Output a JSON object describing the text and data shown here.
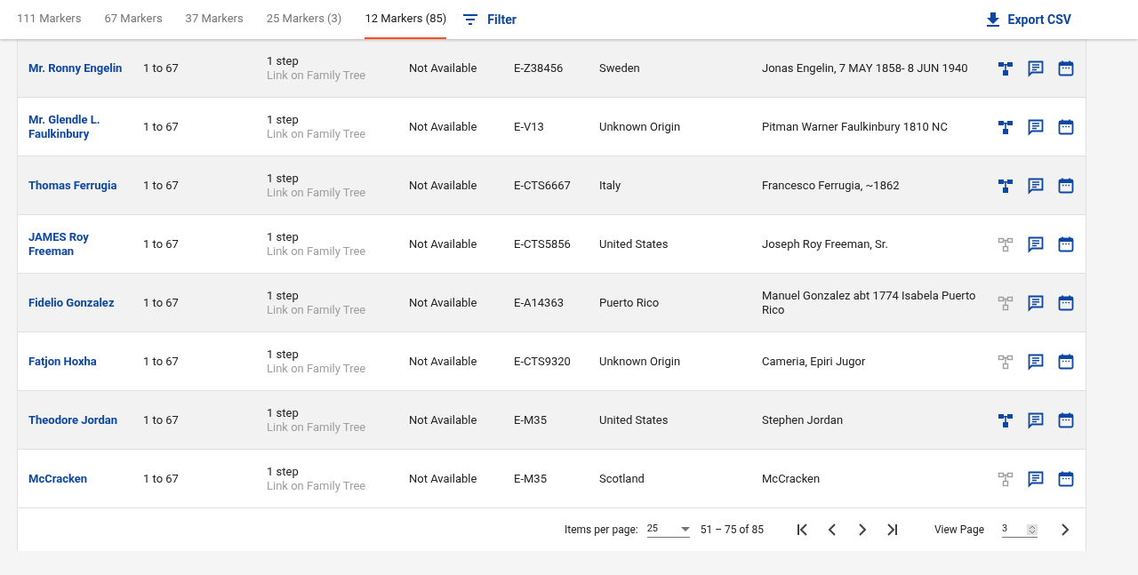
{
  "tabs": [
    {
      "label": "111 Markers",
      "selected": false
    },
    {
      "label": "67 Markers",
      "selected": false
    },
    {
      "label": "37 Markers",
      "selected": false
    },
    {
      "label": "25 Markers (3)",
      "selected": false
    },
    {
      "label": "12 Markers (85)",
      "selected": true
    }
  ],
  "filter_button": "Filter",
  "export_button": "Export CSV",
  "rows": [
    {
      "name": "Mr. Ronny Engelin",
      "markers": "1 to 67",
      "steps": "1 step",
      "link": "Link on Family Tree",
      "availability": "Not Available",
      "haplogroup": "E-Z38456",
      "origin": "Sweden",
      "ancestor": "Jonas Engelin, 7 MAY 1858- 8 JUN 1940",
      "tree_linked": true
    },
    {
      "name": "Mr. Glendle L. Faulkinbury",
      "markers": "1 to 67",
      "steps": "1 step",
      "link": "Link on Family Tree",
      "availability": "Not Available",
      "haplogroup": "E-V13",
      "origin": "Unknown Origin",
      "ancestor": "Pitman Warner Faulkinbury 1810 NC",
      "tree_linked": true
    },
    {
      "name": "Thomas Ferrugia",
      "markers": "1 to 67",
      "steps": "1 step",
      "link": "Link on Family Tree",
      "availability": "Not Available",
      "haplogroup": "E-CTS6667",
      "origin": "Italy",
      "ancestor": "Francesco Ferrugia, ~1862",
      "tree_linked": true
    },
    {
      "name": "JAMES Roy Freeman",
      "markers": "1 to 67",
      "steps": "1 step",
      "link": "Link on Family Tree",
      "availability": "Not Available",
      "haplogroup": "E-CTS5856",
      "origin": "United States",
      "ancestor": "Joseph Roy Freeman, Sr.",
      "tree_linked": false
    },
    {
      "name": "Fidelio Gonzalez",
      "markers": "1 to 67",
      "steps": "1 step",
      "link": "Link on Family Tree",
      "availability": "Not Available",
      "haplogroup": "E-A14363",
      "origin": "Puerto Rico",
      "ancestor": "Manuel Gonzalez abt 1774 Isabela Puerto Rico",
      "tree_linked": false
    },
    {
      "name": "Fatjon Hoxha",
      "markers": "1 to 67",
      "steps": "1 step",
      "link": "Link on Family Tree",
      "availability": "Not Available",
      "haplogroup": "E-CTS9320",
      "origin": "Unknown Origin",
      "ancestor": "Cameria, Epiri Jugor",
      "tree_linked": false
    },
    {
      "name": "Theodore Jordan",
      "markers": "1 to 67",
      "steps": "1 step",
      "link": "Link on Family Tree",
      "availability": "Not Available",
      "haplogroup": "E-M35",
      "origin": "United States",
      "ancestor": "Stephen Jordan",
      "tree_linked": true
    },
    {
      "name": "McCracken",
      "markers": "1 to 67",
      "steps": "1 step",
      "link": "Link on Family Tree",
      "availability": "Not Available",
      "haplogroup": "E-M35",
      "origin": "Scotland",
      "ancestor": "McCracken",
      "tree_linked": false
    }
  ],
  "paginator": {
    "items_per_page_label": "Items per page:",
    "items_per_page": "25",
    "range": "51 – 75 of 85",
    "view_page_label": "View Page",
    "page": "3"
  }
}
